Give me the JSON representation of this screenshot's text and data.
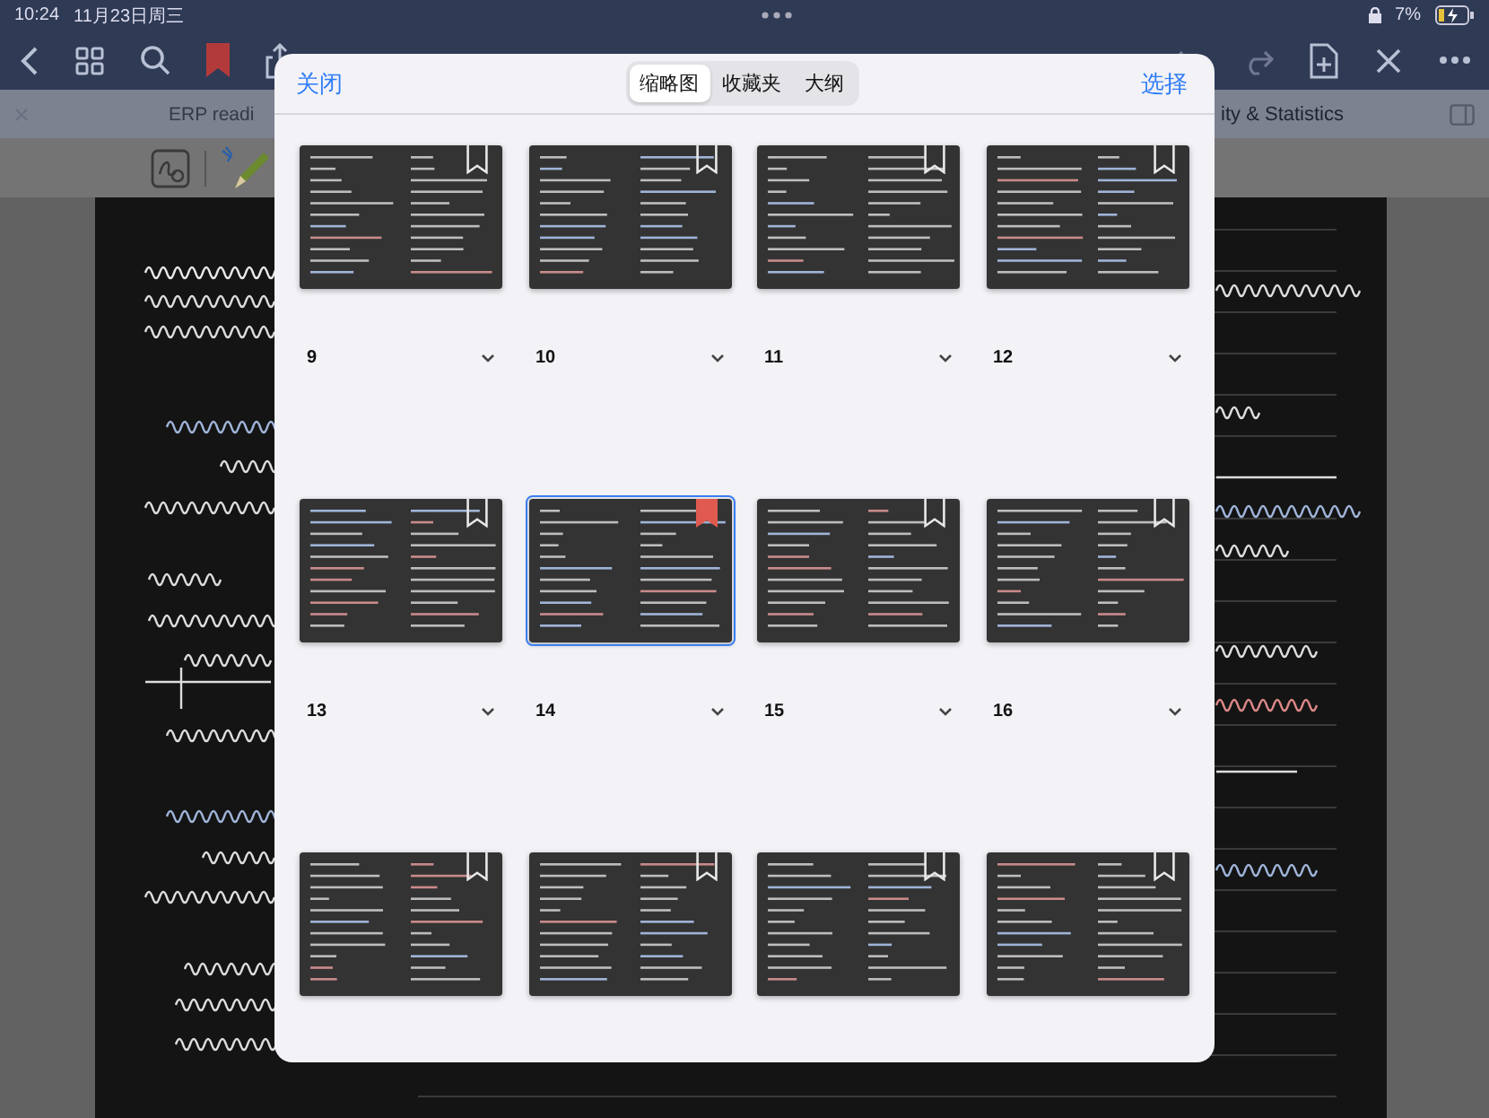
{
  "status_bar": {
    "time": "10:24",
    "date": "11月23日周三",
    "battery": "7%"
  },
  "tabs": [
    {
      "label": "ERP readi",
      "selected": false
    },
    {
      "label": "ity & Statistics",
      "selected": true
    }
  ],
  "modal": {
    "close": "关闭",
    "select": "选择",
    "segments": [
      {
        "label": "缩略图",
        "selected": true
      },
      {
        "label": "收藏夹",
        "selected": false
      },
      {
        "label": "大纲",
        "selected": false
      }
    ],
    "pages": [
      {
        "label": "9",
        "bookmarked": false,
        "selected": false
      },
      {
        "label": "10",
        "bookmarked": false,
        "selected": false
      },
      {
        "label": "11",
        "bookmarked": false,
        "selected": false
      },
      {
        "label": "12",
        "bookmarked": false,
        "selected": false
      },
      {
        "label": "13",
        "bookmarked": false,
        "selected": false
      },
      {
        "label": "14",
        "bookmarked": true,
        "selected": true
      },
      {
        "label": "15",
        "bookmarked": false,
        "selected": false
      },
      {
        "label": "16",
        "bookmarked": false,
        "selected": false
      },
      {
        "bookmarked": false,
        "selected": false
      },
      {
        "bookmarked": false,
        "selected": false
      },
      {
        "bookmarked": false,
        "selected": false
      },
      {
        "bookmarked": false,
        "selected": false
      }
    ]
  }
}
